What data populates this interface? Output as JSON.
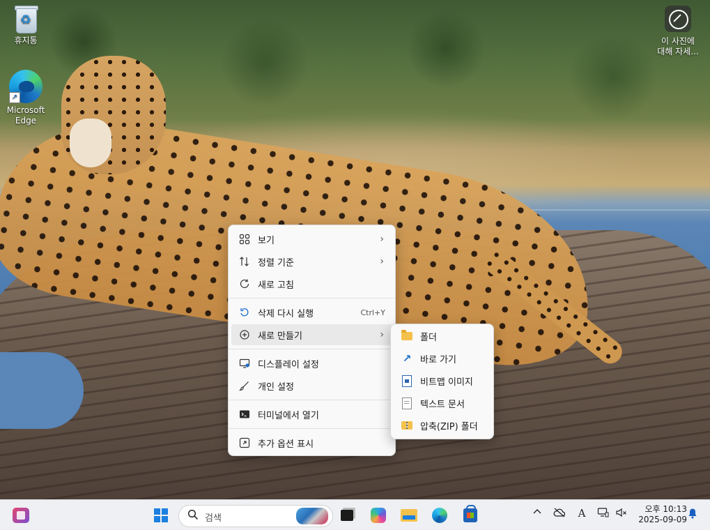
{
  "desktop": {
    "icons": [
      {
        "label": "휴지통",
        "icon": "recycle-bin-icon"
      },
      {
        "label": "Microsoft Edge",
        "icon": "edge-icon"
      },
      {
        "label_line1": "이 사진에",
        "label_line2": "대해 자세...",
        "icon": "spotlight-icon"
      }
    ],
    "edge_label_line1": "Microsoft",
    "edge_label_line2": "Edge"
  },
  "context_menu": {
    "items": [
      {
        "label": "보기",
        "icon": "view-grid-icon",
        "has_submenu": true
      },
      {
        "label": "정렬 기준",
        "icon": "sort-icon",
        "has_submenu": true
      },
      {
        "label": "새로 고침",
        "icon": "refresh-icon"
      },
      {
        "label": "삭제 다시 실행",
        "icon": "redo-delete-icon",
        "shortcut": "Ctrl+Y"
      },
      {
        "label": "새로 만들기",
        "icon": "new-plus-icon",
        "has_submenu": true,
        "highlighted": true
      },
      {
        "label": "디스플레이 설정",
        "icon": "display-settings-icon"
      },
      {
        "label": "개인 설정",
        "icon": "personalize-brush-icon"
      },
      {
        "label": "터미널에서 열기",
        "icon": "terminal-icon"
      },
      {
        "label": "추가 옵션 표시",
        "icon": "more-options-icon"
      }
    ],
    "chevron": "›"
  },
  "new_submenu": {
    "items": [
      {
        "label": "폴더",
        "icon": "folder-icon"
      },
      {
        "label": "바로 가기",
        "icon": "shortcut-arrow-icon"
      },
      {
        "label": "비트맵 이미지",
        "icon": "bitmap-file-icon"
      },
      {
        "label": "텍스트 문서",
        "icon": "text-document-icon"
      },
      {
        "label": "압축(ZIP) 폴더",
        "icon": "zip-folder-icon"
      }
    ]
  },
  "taskbar": {
    "search_placeholder": "검색",
    "clock_time": "오후 10:13",
    "clock_date": "2025-09-09",
    "input_indicator": "A"
  },
  "colors": {
    "accent": "#1a7fe0",
    "menu_bg": "#f9f9f9",
    "menu_highlight": "#e9e9e9",
    "taskbar_bg": "#eef0f3"
  }
}
